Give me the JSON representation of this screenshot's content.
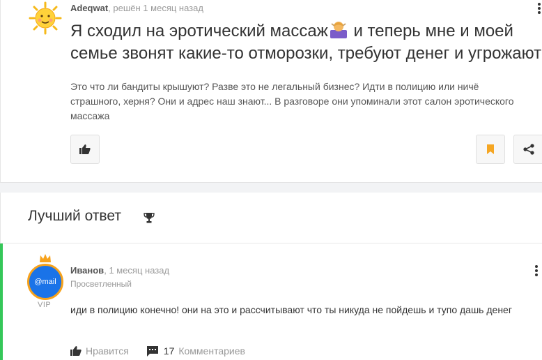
{
  "question": {
    "author": "Adeqwat",
    "meta": ", решён 1 месяц назад",
    "title_line1": "Я сходил на эротический массаж",
    "title_line1_rest": " и теперь мне и моей",
    "title_line2": "семье звонят какие-то отморозки, требуют денег и угрожают",
    "body": "Это что ли бандиты крышуют? Разве это не легальный бизнес? Идти в полицию или ничё страшного, херня? Они и адрес наш знают... В разговоре они упоминали этот салон эротического массажа",
    "bookmark_color": "#f5a623"
  },
  "best_answer": {
    "heading": "Лучший ответ",
    "author": "Иванов",
    "meta": ", 1 месяц назад",
    "rank": "Просветленный",
    "avatar_text": "@mail",
    "badge": "VIP",
    "text": "иди в полицию конечно! они на это и рассчитывают что ты никуда не пойдешь и тупо дашь денег",
    "like_label": "Нравится",
    "comments_count": "17",
    "comments_label": "Комментариев",
    "accent_color": "#35c759"
  }
}
